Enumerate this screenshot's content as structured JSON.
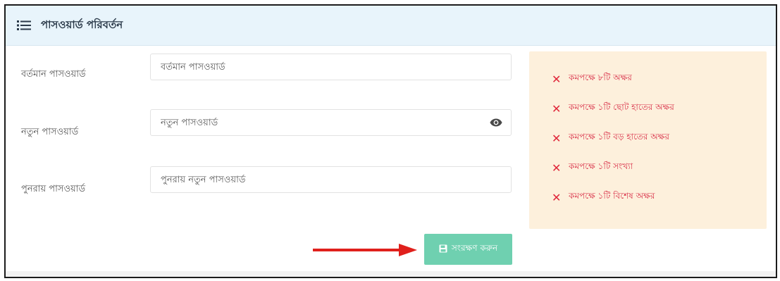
{
  "header": {
    "title": "পাসওয়ার্ড পরিবর্তন",
    "icon": "list-icon"
  },
  "form": {
    "current": {
      "label": "বর্তমান পাসওয়ার্ড",
      "placeholder": "বর্তমান পাসওয়ার্ড",
      "value": ""
    },
    "new": {
      "label": "নতুন পাসওয়ার্ড",
      "placeholder": "নতুন পাসওয়ার্ড",
      "value": "",
      "toggle_icon": "eye-icon"
    },
    "confirm": {
      "label": "পুনরায় পাসওয়ার্ড",
      "placeholder": "পুনরায় নতুন পাসওয়ার্ড",
      "value": ""
    }
  },
  "rules": {
    "status_icon": "cross-icon",
    "items": [
      "কমপক্ষে ৮টি অক্ষর",
      "কমপক্ষে ১টি ছোট হাতের অক্ষর",
      "কমপক্ষে ১টি বড় হাতের অক্ষর",
      "কমপক্ষে ১টি সংখ্যা",
      "কমপক্ষে ১টি বিশেষ অক্ষর"
    ]
  },
  "save_button": {
    "label": "সংরক্ষণ করুন",
    "icon": "floppy-disk-icon"
  },
  "colors": {
    "header_bg": "#e8f4fb",
    "rules_bg": "#fdf0dc",
    "rule_text": "#d9324a",
    "save_button_bg": "#6fd0b0",
    "annotation_arrow": "#e0201c"
  }
}
